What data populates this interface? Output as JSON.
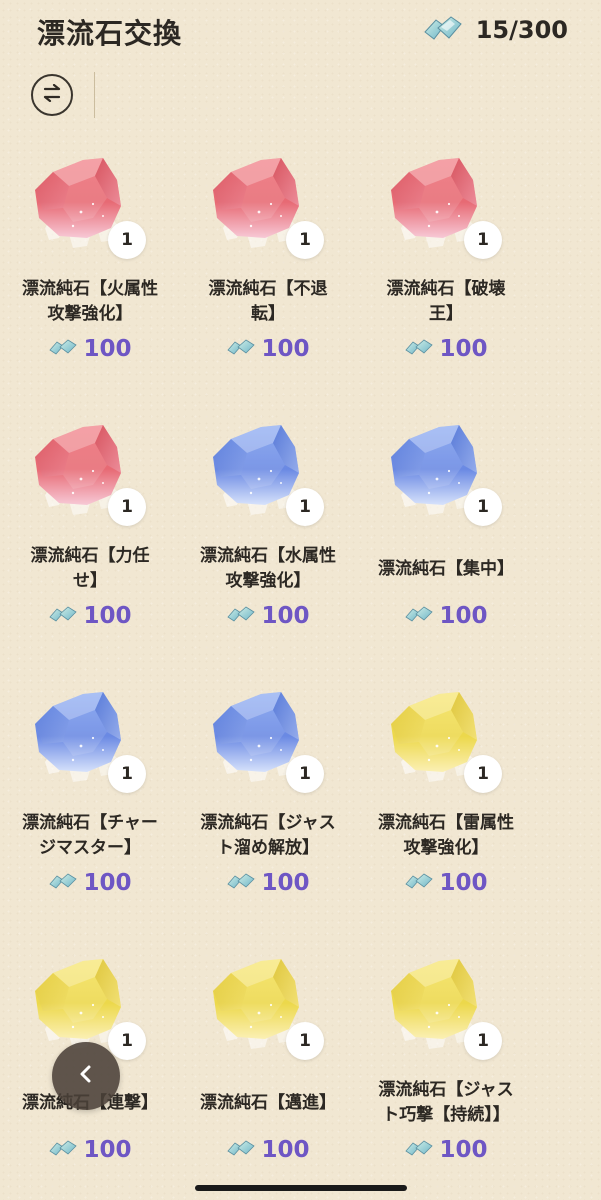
{
  "header": {
    "title": "漂流石交換",
    "currency_icon": "crystal-shards-icon",
    "currency_count": "15/300"
  },
  "toolbar": {
    "swap_icon": "swap-arrows-icon"
  },
  "colors": {
    "red": "#e5636d",
    "blue": "#6e8fe6",
    "yellow": "#e9d548",
    "price": "#6e56c4",
    "background": "#f1e7d2"
  },
  "items": [
    {
      "name": "漂流純石【火属性攻撃強化】",
      "line1": "漂流純石【火属性",
      "line2": "攻撃強化】",
      "color": "red",
      "quantity": "1",
      "price": "100"
    },
    {
      "name": "漂流純石【不退転】",
      "line1": "漂流純石【不退",
      "line2": "転】",
      "color": "red",
      "quantity": "1",
      "price": "100"
    },
    {
      "name": "漂流純石【破壊王】",
      "line1": "漂流純石【破壊",
      "line2": "王】",
      "color": "red",
      "quantity": "1",
      "price": "100"
    },
    {
      "name": "漂流純石【力任せ】",
      "line1": "漂流純石【力任",
      "line2": "せ】",
      "color": "red",
      "quantity": "1",
      "price": "100"
    },
    {
      "name": "漂流純石【水属性攻撃強化】",
      "line1": "漂流純石【水属性",
      "line2": "攻撃強化】",
      "color": "blue",
      "quantity": "1",
      "price": "100"
    },
    {
      "name": "漂流純石【集中】",
      "line1": "漂流純石【集中】",
      "line2": "",
      "color": "blue",
      "quantity": "1",
      "price": "100"
    },
    {
      "name": "漂流純石【チャージマスター】",
      "line1": "漂流純石【チャー",
      "line2": "ジマスター】",
      "color": "blue",
      "quantity": "1",
      "price": "100"
    },
    {
      "name": "漂流純石【ジャスト溜め解放】",
      "line1": "漂流純石【ジャス",
      "line2": "ト溜め解放】",
      "color": "blue",
      "quantity": "1",
      "price": "100"
    },
    {
      "name": "漂流純石【雷属性攻撃強化】",
      "line1": "漂流純石【雷属性",
      "line2": "攻撃強化】",
      "color": "yellow",
      "quantity": "1",
      "price": "100"
    },
    {
      "name": "漂流純石【連撃】",
      "line1": "漂流純石【連撃】",
      "line2": "",
      "color": "yellow",
      "quantity": "1",
      "price": "100"
    },
    {
      "name": "漂流純石【邁進】",
      "line1": "漂流純石【邁進】",
      "line2": "",
      "color": "yellow",
      "quantity": "1",
      "price": "100"
    },
    {
      "name": "漂流純石【ジャスト巧撃【持続】】",
      "line1": "漂流純石【ジャス",
      "line2": "ト巧撃【持続】】",
      "color": "yellow",
      "quantity": "1",
      "price": "100"
    }
  ],
  "back_button": {
    "icon": "chevron-left-icon"
  }
}
